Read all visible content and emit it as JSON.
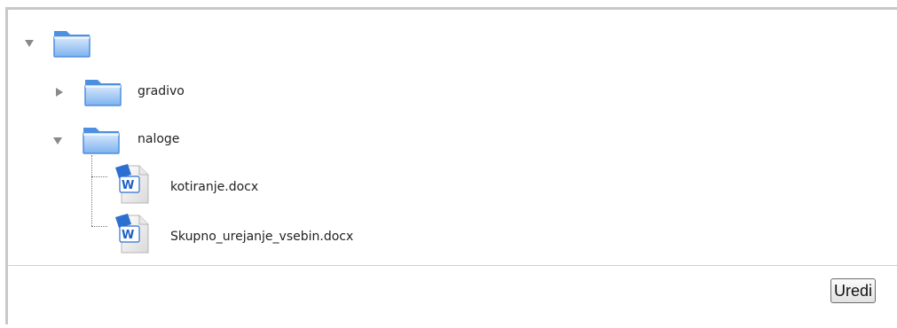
{
  "tree": {
    "root": {
      "label": "",
      "expanded": true,
      "icon": "folder-icon"
    },
    "children": [
      {
        "label": "gradivo",
        "expanded": false,
        "icon": "folder-icon"
      },
      {
        "label": "naloge",
        "expanded": true,
        "icon": "folder-icon",
        "files": [
          {
            "label": "kotiranje.docx",
            "icon": "word-document-icon"
          },
          {
            "label": "Skupno_urejanje_vsebin.docx",
            "icon": "word-document-icon"
          }
        ]
      }
    ]
  },
  "footer": {
    "edit_label": "Uredi"
  },
  "colors": {
    "folder_light": "#cfe3fb",
    "folder_dark": "#4d8fe0",
    "toggle": "#8a8a8a",
    "border": "#c8c8c8"
  }
}
